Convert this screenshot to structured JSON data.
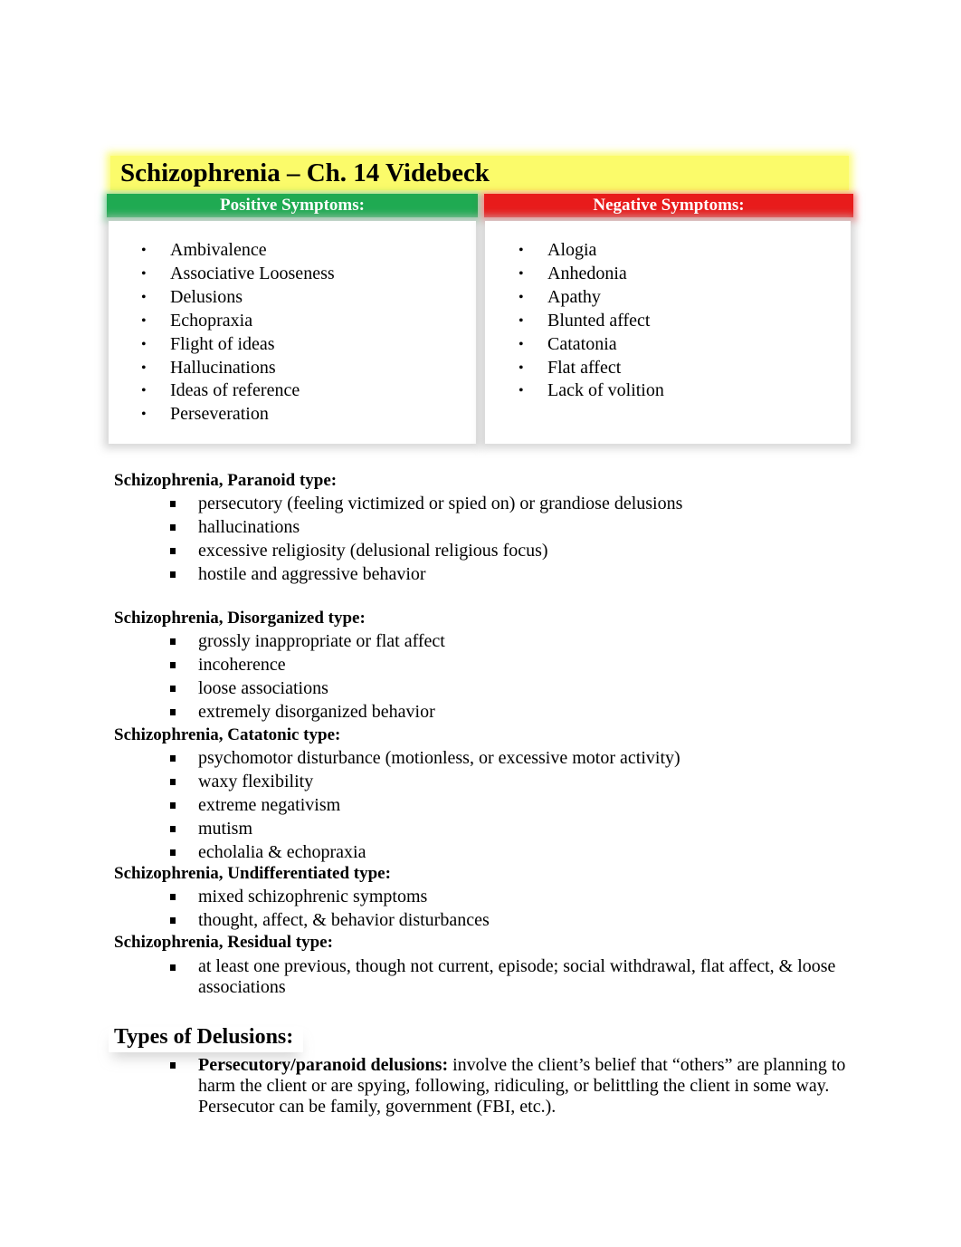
{
  "title": "Schizophrenia – Ch. 14 Videbeck",
  "colors": {
    "title_bg": "#fbfb6a",
    "positive_header": "#1faa52",
    "negative_header": "#e81b1b"
  },
  "symptom_table": {
    "positive": {
      "header": "Positive Symptoms:",
      "bullet_icon": "•",
      "items": [
        "Ambivalence",
        "Associative Looseness",
        "Delusions",
        "Echopraxia",
        "Flight of ideas",
        "Hallucinations",
        "Ideas of reference",
        "Perseveration"
      ]
    },
    "negative": {
      "header": "Negative Symptoms:",
      "bullet_icon": "•",
      "items": [
        "Alogia",
        "Anhedonia",
        "Apathy",
        "Blunted affect",
        "Catatonia",
        "Flat affect",
        "Lack of volition"
      ]
    }
  },
  "types": [
    {
      "heading": "Schizophrenia, Paranoid type:",
      "items": [
        "persecutory (feeling victimized or spied on) or grandiose delusions",
        "hallucinations",
        "excessive religiosity (delusional religious focus)",
        "hostile and aggressive behavior"
      ]
    },
    {
      "heading": "Schizophrenia, Disorganized type:",
      "items": [
        "grossly inappropriate or flat affect",
        "incoherence",
        "loose associations",
        "extremely disorganized behavior"
      ]
    },
    {
      "heading": "Schizophrenia, Catatonic type:",
      "items": [
        "psychomotor disturbance (motionless, or excessive motor activity)",
        "waxy flexibility",
        "extreme negativism",
        "mutism",
        "echolalia & echopraxia"
      ]
    },
    {
      "heading": "Schizophrenia, Undifferentiated type:",
      "items": [
        "mixed schizophrenic symptoms",
        "thought, affect, & behavior disturbances"
      ]
    },
    {
      "heading": "Schizophrenia, Residual type:",
      "items": [
        "at least one previous, though not current, episode; social withdrawal, flat affect, & loose associations"
      ]
    }
  ],
  "delusions": {
    "heading": "Types of Delusions:",
    "items": [
      {
        "term": "Persecutory/paranoid delusions:",
        "text": " involve the client’s belief that “others” are planning to harm the client or are spying, following, ridiculing, or belittling the client in some way.  Persecutor can be family, government (FBI, etc.)."
      }
    ]
  }
}
